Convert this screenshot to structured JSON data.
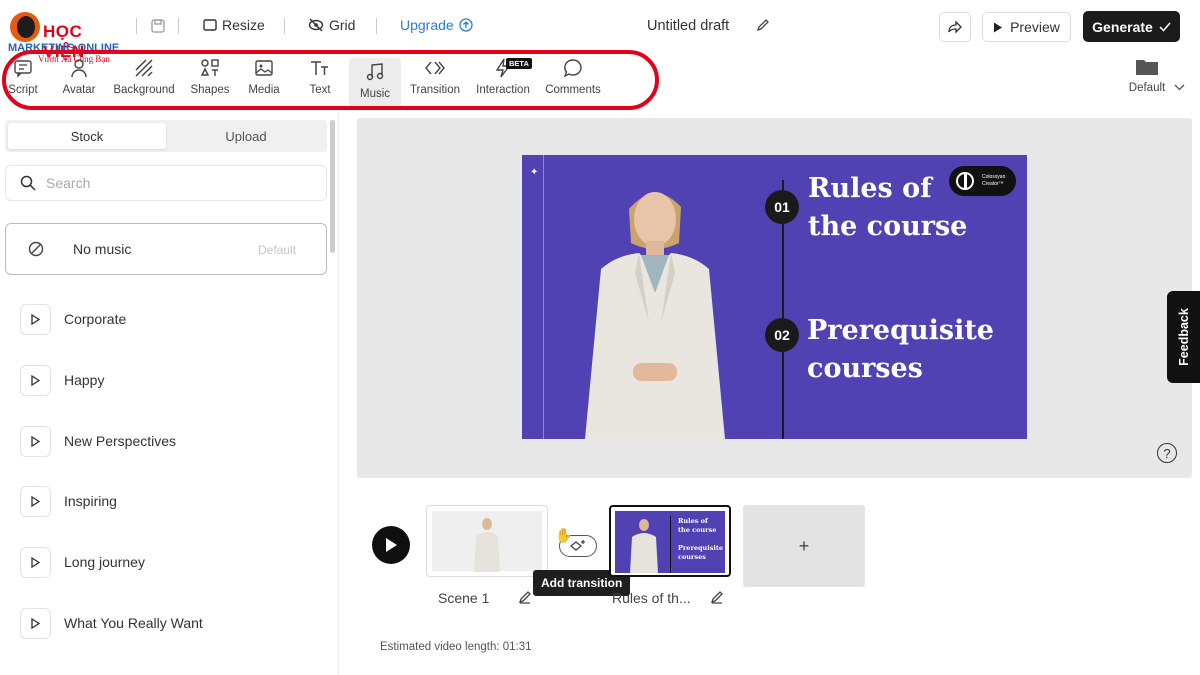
{
  "brand": {
    "name": "HỌC VIỆN",
    "sub": "MARKETING ONLINE",
    "tagline": "Vươn Xa Cùng Bạn"
  },
  "header": {
    "resize": "Resize",
    "grid": "Grid",
    "upgrade": "Upgrade",
    "title": "Untitled draft",
    "preview": "Preview",
    "generate": "Generate"
  },
  "toolbar": {
    "items": [
      {
        "label": "Script",
        "icon": "script-icon"
      },
      {
        "label": "Avatar",
        "icon": "avatar-icon"
      },
      {
        "label": "Background",
        "icon": "background-icon"
      },
      {
        "label": "Shapes",
        "icon": "shapes-icon"
      },
      {
        "label": "Media",
        "icon": "media-icon"
      },
      {
        "label": "Text",
        "icon": "text-icon"
      },
      {
        "label": "Music",
        "icon": "music-icon"
      },
      {
        "label": "Transition",
        "icon": "transition-icon"
      },
      {
        "label": "Interaction",
        "icon": "interaction-icon"
      },
      {
        "label": "Comments",
        "icon": "comments-icon"
      }
    ],
    "beta_badge": "BETA",
    "template": "Default"
  },
  "panel": {
    "tabs": [
      "Stock",
      "Upload"
    ],
    "search_placeholder": "Search",
    "no_music": "No music",
    "default_tag": "Default",
    "tracks": [
      "Corporate",
      "Happy",
      "New Perspectives",
      "Inspiring",
      "Long journey",
      "What You Really Want"
    ]
  },
  "slide": {
    "item1_num": "01",
    "item1_text1": "Rules of",
    "item1_text2": "the course",
    "item2_num": "02",
    "item2_text1": "Prerequisite",
    "item2_text2": "courses",
    "logo_text1": "Colossyan",
    "logo_text2": "Creator™"
  },
  "feedback": "Feedback",
  "help": "?",
  "timeline": {
    "scene1_label": "Scene 1",
    "scene2_label": "Rules of th...",
    "add_scene": "+",
    "tooltip": "Add transition",
    "thumb_line1": "Rules of",
    "thumb_line2": "the course",
    "thumb_line3": "Prerequisite",
    "thumb_line4": "courses",
    "video_length": "Estimated video length: 01:31"
  }
}
